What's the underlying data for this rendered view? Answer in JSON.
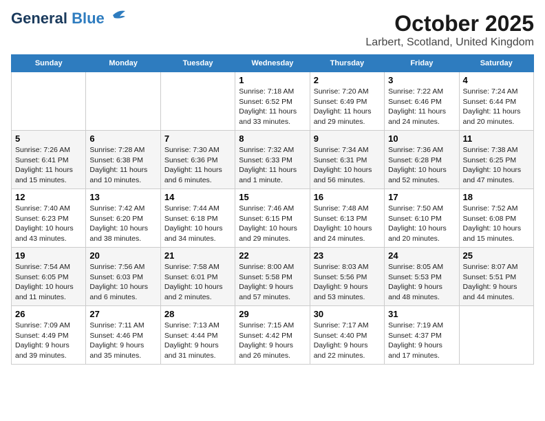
{
  "logo": {
    "line1": "General",
    "line2": "Blue"
  },
  "title": "October 2025",
  "subtitle": "Larbert, Scotland, United Kingdom",
  "days": [
    "Sunday",
    "Monday",
    "Tuesday",
    "Wednesday",
    "Thursday",
    "Friday",
    "Saturday"
  ],
  "weeks": [
    [
      {
        "day": "",
        "data": ""
      },
      {
        "day": "",
        "data": ""
      },
      {
        "day": "",
        "data": ""
      },
      {
        "day": "1",
        "data": "Sunrise: 7:18 AM\nSunset: 6:52 PM\nDaylight: 11 hours and 33 minutes."
      },
      {
        "day": "2",
        "data": "Sunrise: 7:20 AM\nSunset: 6:49 PM\nDaylight: 11 hours and 29 minutes."
      },
      {
        "day": "3",
        "data": "Sunrise: 7:22 AM\nSunset: 6:46 PM\nDaylight: 11 hours and 24 minutes."
      },
      {
        "day": "4",
        "data": "Sunrise: 7:24 AM\nSunset: 6:44 PM\nDaylight: 11 hours and 20 minutes."
      }
    ],
    [
      {
        "day": "5",
        "data": "Sunrise: 7:26 AM\nSunset: 6:41 PM\nDaylight: 11 hours and 15 minutes."
      },
      {
        "day": "6",
        "data": "Sunrise: 7:28 AM\nSunset: 6:38 PM\nDaylight: 11 hours and 10 minutes."
      },
      {
        "day": "7",
        "data": "Sunrise: 7:30 AM\nSunset: 6:36 PM\nDaylight: 11 hours and 6 minutes."
      },
      {
        "day": "8",
        "data": "Sunrise: 7:32 AM\nSunset: 6:33 PM\nDaylight: 11 hours and 1 minute."
      },
      {
        "day": "9",
        "data": "Sunrise: 7:34 AM\nSunset: 6:31 PM\nDaylight: 10 hours and 56 minutes."
      },
      {
        "day": "10",
        "data": "Sunrise: 7:36 AM\nSunset: 6:28 PM\nDaylight: 10 hours and 52 minutes."
      },
      {
        "day": "11",
        "data": "Sunrise: 7:38 AM\nSunset: 6:25 PM\nDaylight: 10 hours and 47 minutes."
      }
    ],
    [
      {
        "day": "12",
        "data": "Sunrise: 7:40 AM\nSunset: 6:23 PM\nDaylight: 10 hours and 43 minutes."
      },
      {
        "day": "13",
        "data": "Sunrise: 7:42 AM\nSunset: 6:20 PM\nDaylight: 10 hours and 38 minutes."
      },
      {
        "day": "14",
        "data": "Sunrise: 7:44 AM\nSunset: 6:18 PM\nDaylight: 10 hours and 34 minutes."
      },
      {
        "day": "15",
        "data": "Sunrise: 7:46 AM\nSunset: 6:15 PM\nDaylight: 10 hours and 29 minutes."
      },
      {
        "day": "16",
        "data": "Sunrise: 7:48 AM\nSunset: 6:13 PM\nDaylight: 10 hours and 24 minutes."
      },
      {
        "day": "17",
        "data": "Sunrise: 7:50 AM\nSunset: 6:10 PM\nDaylight: 10 hours and 20 minutes."
      },
      {
        "day": "18",
        "data": "Sunrise: 7:52 AM\nSunset: 6:08 PM\nDaylight: 10 hours and 15 minutes."
      }
    ],
    [
      {
        "day": "19",
        "data": "Sunrise: 7:54 AM\nSunset: 6:05 PM\nDaylight: 10 hours and 11 minutes."
      },
      {
        "day": "20",
        "data": "Sunrise: 7:56 AM\nSunset: 6:03 PM\nDaylight: 10 hours and 6 minutes."
      },
      {
        "day": "21",
        "data": "Sunrise: 7:58 AM\nSunset: 6:01 PM\nDaylight: 10 hours and 2 minutes."
      },
      {
        "day": "22",
        "data": "Sunrise: 8:00 AM\nSunset: 5:58 PM\nDaylight: 9 hours and 57 minutes."
      },
      {
        "day": "23",
        "data": "Sunrise: 8:03 AM\nSunset: 5:56 PM\nDaylight: 9 hours and 53 minutes."
      },
      {
        "day": "24",
        "data": "Sunrise: 8:05 AM\nSunset: 5:53 PM\nDaylight: 9 hours and 48 minutes."
      },
      {
        "day": "25",
        "data": "Sunrise: 8:07 AM\nSunset: 5:51 PM\nDaylight: 9 hours and 44 minutes."
      }
    ],
    [
      {
        "day": "26",
        "data": "Sunrise: 7:09 AM\nSunset: 4:49 PM\nDaylight: 9 hours and 39 minutes."
      },
      {
        "day": "27",
        "data": "Sunrise: 7:11 AM\nSunset: 4:46 PM\nDaylight: 9 hours and 35 minutes."
      },
      {
        "day": "28",
        "data": "Sunrise: 7:13 AM\nSunset: 4:44 PM\nDaylight: 9 hours and 31 minutes."
      },
      {
        "day": "29",
        "data": "Sunrise: 7:15 AM\nSunset: 4:42 PM\nDaylight: 9 hours and 26 minutes."
      },
      {
        "day": "30",
        "data": "Sunrise: 7:17 AM\nSunset: 4:40 PM\nDaylight: 9 hours and 22 minutes."
      },
      {
        "day": "31",
        "data": "Sunrise: 7:19 AM\nSunset: 4:37 PM\nDaylight: 9 hours and 17 minutes."
      },
      {
        "day": "",
        "data": ""
      }
    ]
  ]
}
